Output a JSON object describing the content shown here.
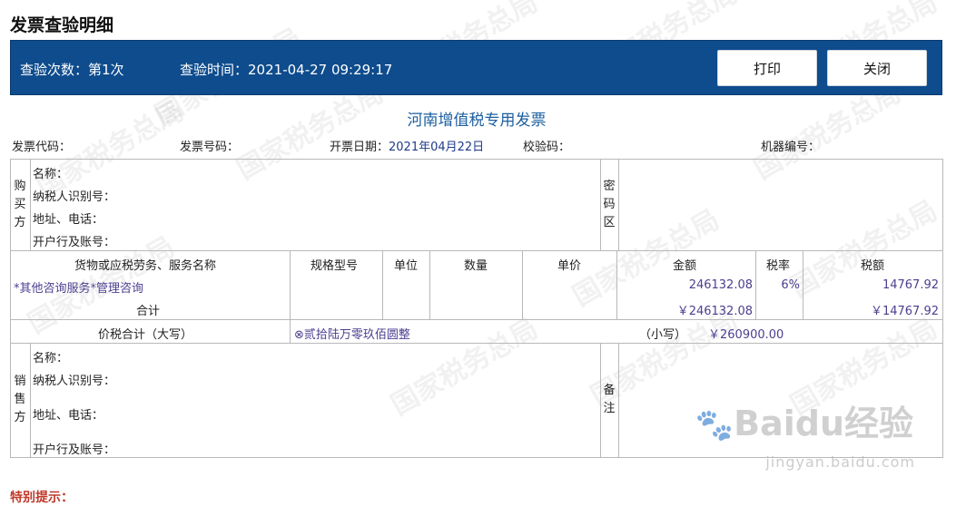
{
  "page_title": "发票查验明细",
  "info_bar": {
    "check_count_label": "查验次数：",
    "check_count_value": "第1次",
    "check_time_label": "查验时间：",
    "check_time_value": "2021-04-27 09:29:17",
    "print_label": "打印",
    "close_label": "关闭"
  },
  "invoice_title": "河南增值税专用发票",
  "meta": {
    "code_label": "发票代码：",
    "number_label": "发票号码：",
    "date_label": "开票日期：",
    "date_value": "2021年04月22日",
    "check_code_label": "校验码：",
    "machine_label": "机器编号："
  },
  "buyer": {
    "side_label": "购买方",
    "name_label": "名称：",
    "tax_id_label": "纳税人识别号：",
    "address_label": "地址、电话：",
    "bank_label": "开户行及账号：",
    "password_label": "密码区"
  },
  "items_table": {
    "headers": [
      "货物或应税劳务、服务名称",
      "规格型号",
      "单位",
      "数量",
      "单价",
      "金额",
      "税率",
      "税额"
    ],
    "rows": [
      {
        "name": "*其他咨询服务*管理咨询",
        "spec": "",
        "unit": "",
        "qty": "",
        "price": "",
        "amount": "246132.08",
        "rate": "6%",
        "tax": "14767.92"
      }
    ],
    "total_label": "合计",
    "total_amount": "￥246132.08",
    "total_tax": "￥14767.92"
  },
  "total_in_words": {
    "label": "价税合计（大写）",
    "value": "⊗贰拾陆万零玖佰圆整",
    "small_label": "（小写）",
    "small_value": "￥260900.00"
  },
  "seller": {
    "side_label": "销售方",
    "name_label": "名称：",
    "tax_id_label": "纳税人识别号：",
    "address_label": "地址、电话：",
    "bank_label": "开户行及账号：",
    "remark_label": "备注"
  },
  "watermark": {
    "text": "国家税务总局",
    "baidu_logo": "Baidu经验",
    "baidu_url": "jingyan.baidu.com"
  },
  "bottom_note": "特别提示："
}
